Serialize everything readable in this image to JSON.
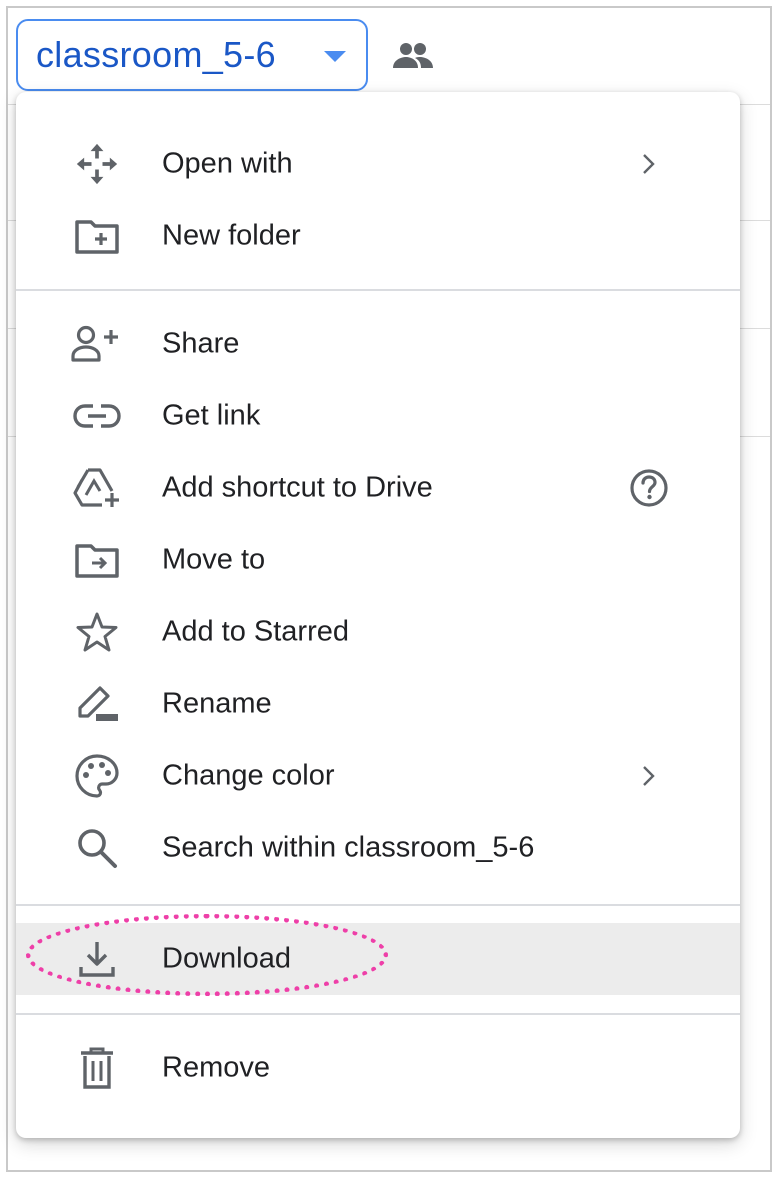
{
  "header": {
    "folder_name": "classroom_5-6",
    "folder_icon": "chevron-down-icon",
    "shared_icon": "people-icon"
  },
  "menu": {
    "items": [
      {
        "label": "Open with",
        "icon": "open-with-icon",
        "submenu": true
      },
      {
        "label": "New folder",
        "icon": "new-folder-icon"
      },
      {
        "label": "Share",
        "icon": "person-add-icon"
      },
      {
        "label": "Get link",
        "icon": "link-icon"
      },
      {
        "label": "Add shortcut to Drive",
        "icon": "add-shortcut-icon",
        "help": true
      },
      {
        "label": "Move to",
        "icon": "move-to-folder-icon"
      },
      {
        "label": "Add to Starred",
        "icon": "star-icon"
      },
      {
        "label": "Rename",
        "icon": "rename-pencil-icon"
      },
      {
        "label": "Change color",
        "icon": "palette-icon",
        "submenu": true
      },
      {
        "label": "Search within classroom_5-6",
        "icon": "search-icon"
      },
      {
        "label": "Download",
        "icon": "download-icon",
        "highlighted": true
      },
      {
        "label": "Remove",
        "icon": "trash-icon"
      }
    ]
  },
  "colors": {
    "accent": "#1a57c6",
    "chip_border": "#4a8cf0",
    "annotation": "#ee3fa8",
    "icon": "#5f6368",
    "highlight_bg": "#ececec"
  }
}
